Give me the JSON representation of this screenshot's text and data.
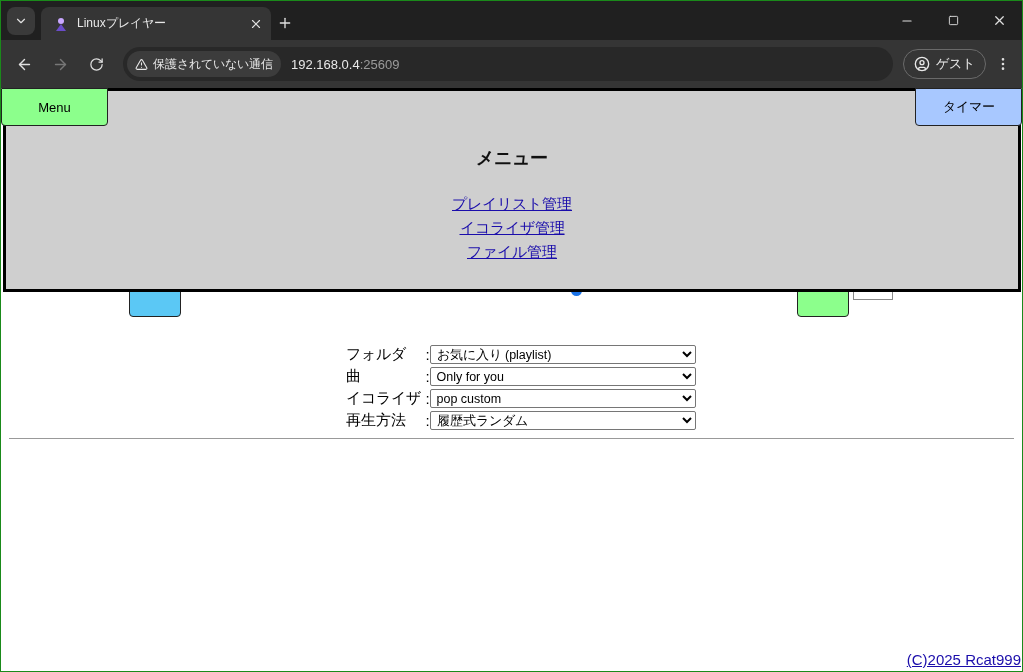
{
  "browser": {
    "tab_title": "Linuxプレイヤー",
    "security_label": "保護されていない通信",
    "url_host": "192.168.0.4",
    "url_port": ":25609",
    "profile": "ゲスト"
  },
  "menu_button": "Menu",
  "timer_button": "タイマー",
  "menu_panel": {
    "title": "メニュー",
    "links": [
      "プレイリスト管理",
      "イコライザ管理",
      "ファイル管理"
    ]
  },
  "settings": [
    {
      "label": "フォルダ",
      "separator": ":",
      "value": "お気に入り (playlist)"
    },
    {
      "label": "曲",
      "separator": ":",
      "value": "Only for you"
    },
    {
      "label": "イコライザ",
      "separator": ":",
      "value": "pop custom"
    },
    {
      "label": "再生方法",
      "separator": ":",
      "value": "履歴式ランダム"
    }
  ],
  "footer_link": "(C)2025 Rcat999"
}
